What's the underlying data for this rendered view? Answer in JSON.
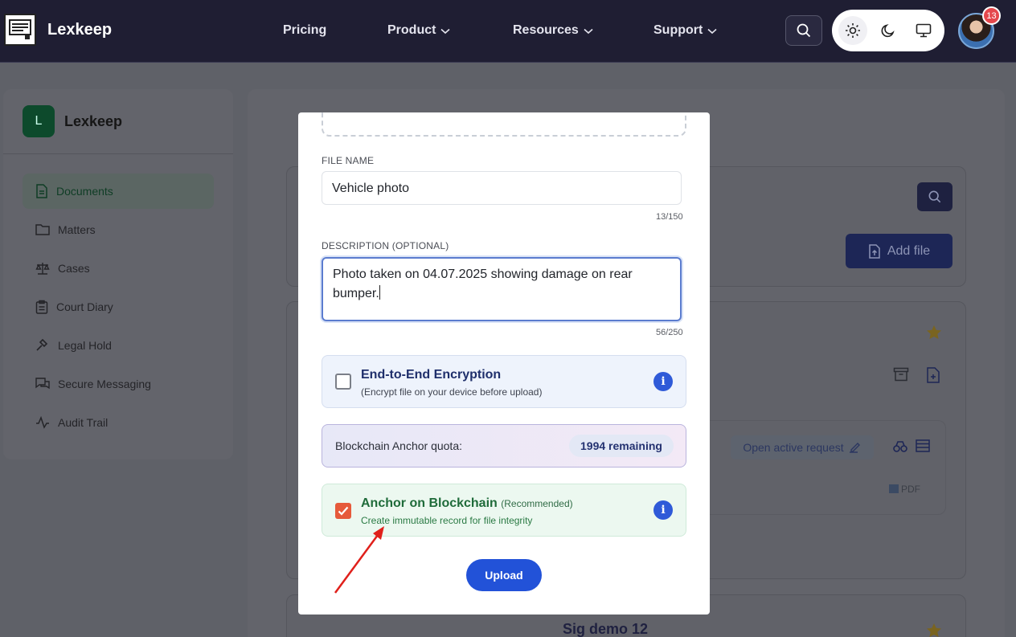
{
  "nav": {
    "brand": "Lexkeep",
    "items": [
      {
        "label": "Pricing",
        "dropdown": false
      },
      {
        "label": "Product",
        "dropdown": true
      },
      {
        "label": "Resources",
        "dropdown": true
      },
      {
        "label": "Support",
        "dropdown": true
      }
    ],
    "notification_count": "13",
    "theme_active": "light"
  },
  "sidebar": {
    "logo_letter": "L",
    "brand": "Lexkeep",
    "items": [
      {
        "label": "Documents",
        "icon": "document-icon",
        "active": true
      },
      {
        "label": "Matters",
        "icon": "folder-icon",
        "active": false
      },
      {
        "label": "Cases",
        "icon": "scale-icon",
        "active": false
      },
      {
        "label": "Court Diary",
        "icon": "clipboard-icon",
        "active": false
      },
      {
        "label": "Legal Hold",
        "icon": "gavel-icon",
        "active": false
      },
      {
        "label": "Secure Messaging",
        "icon": "chat-icon",
        "active": false
      },
      {
        "label": "Audit Trail",
        "icon": "activity-icon",
        "active": false
      }
    ]
  },
  "background": {
    "add_file_label": "Add file",
    "open_request_label": "Open active request",
    "file_type": "PDF",
    "next_doc_title": "Sig demo 12"
  },
  "modal": {
    "file_name_label": "FILE NAME",
    "file_name_value": "Vehicle photo",
    "file_name_counter": "13/150",
    "description_label": "DESCRIPTION (OPTIONAL)",
    "description_value": "Photo taken on 04.07.2025 showing damage on rear bumper.",
    "description_counter": "56/250",
    "encryption": {
      "title": "End-to-End Encryption",
      "subtitle": "(Encrypt file on your device before upload)",
      "checked": false
    },
    "quota": {
      "label": "Blockchain Anchor quota:",
      "value": "1994 remaining"
    },
    "anchor": {
      "title": "Anchor on Blockchain",
      "tag": "(Recommended)",
      "subtitle": "Create immutable record for file integrity",
      "checked": true
    },
    "upload_label": "Upload"
  },
  "colors": {
    "navbar": "#1f1e33",
    "primary": "#2252d8",
    "anchor_green": "#1f6b3a",
    "check_orange": "#e65a3b",
    "encryption_title": "#1f2f6b",
    "arrow_red": "#e0201b"
  }
}
